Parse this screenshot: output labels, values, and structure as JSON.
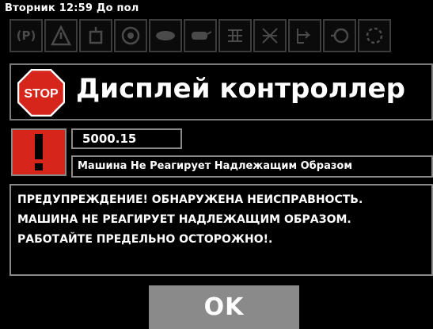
{
  "status_bar": {
    "text": "Вторник 12:59 До пол"
  },
  "indicators": [
    {
      "name": "parking-brake-icon",
      "glyph": "(P)"
    },
    {
      "name": "warning-icon",
      "glyph": "⚠"
    },
    {
      "name": "hydraulic-icon",
      "glyph": "⛽"
    },
    {
      "name": "engine-coolant-icon",
      "glyph": "◎"
    },
    {
      "name": "oil-pressure-icon",
      "glyph": "⬬"
    },
    {
      "name": "oil-can-icon",
      "glyph": "⬮"
    },
    {
      "name": "transmission-icon",
      "glyph": "⇶"
    },
    {
      "name": "filter-icon",
      "glyph": "✕"
    },
    {
      "name": "fuel-icon",
      "glyph": "⇒"
    },
    {
      "name": "rpm-icon",
      "glyph": "⊖"
    },
    {
      "name": "oil-level-icon",
      "glyph": "◌"
    }
  ],
  "header": {
    "stop_label": "STOP",
    "title": "Дисплей контроллер"
  },
  "alert": {
    "code": "5000.15",
    "short_message": "Машина Не Реагирует Надлежащим Образом",
    "warning_text": "ПРЕДУПРЕЖДЕНИЕ! ОБНАРУЖЕНА НЕИСПРАВНОСТЬ. МАШИНА НЕ РЕАГИРУЕТ НАДЛЕЖАЩИМ ОБРАЗОМ. РАБОТАЙТЕ ПРЕДЕЛЬНО ОСТОРОЖНО!."
  },
  "buttons": {
    "ok_label": "OK"
  },
  "colors": {
    "alert_red": "#d6261c",
    "button_gray": "#8a8a8a",
    "background": "#000000"
  }
}
